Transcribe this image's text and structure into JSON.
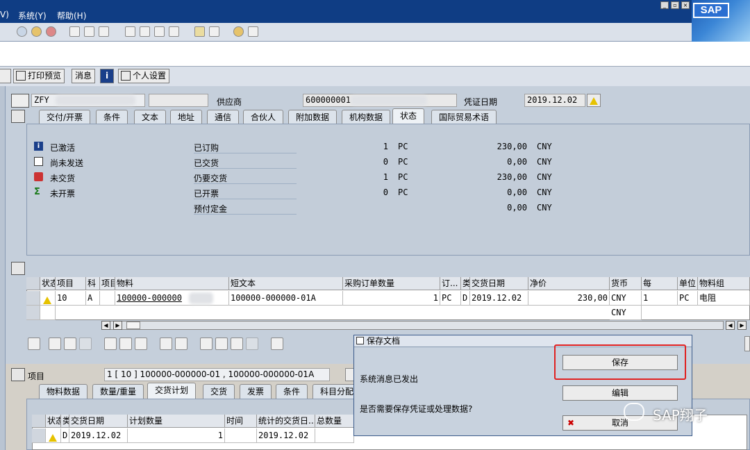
{
  "menu": {
    "view": "V)",
    "system": "系统(Y)",
    "help": "帮助(H)"
  },
  "toolbar_icons": [
    "back-icon",
    "exit-icon",
    "cancel-icon",
    "print-icon",
    "find-icon",
    "find-next-icon",
    "first-page-icon",
    "prev-page-icon",
    "next-page-icon",
    "last-page-icon",
    "new-session-icon",
    "shortcut-icon",
    "help-icon",
    "layout-icon"
  ],
  "app_toolbar": {
    "print_preview": "打印预览",
    "messages": "消息",
    "personal_settings": "个人设置"
  },
  "header": {
    "doc_type": "ZFY",
    "vendor_label": "供应商",
    "vendor_value": "600000001",
    "doc_date_label": "凭证日期",
    "doc_date_value": "2019.12.02"
  },
  "header_tabs": [
    "交付/开票",
    "条件",
    "文本",
    "地址",
    "通信",
    "合伙人",
    "附加数据",
    "机构数据",
    "状态",
    "国际贸易术语"
  ],
  "status_panel": {
    "flags": [
      {
        "icon": "info-icon",
        "label": "已激活"
      },
      {
        "icon": "printer-icon",
        "label": "尚未发送"
      },
      {
        "icon": "truck-icon",
        "label": "未交货"
      },
      {
        "icon": "sigma-icon",
        "label": "未开票"
      }
    ],
    "rows": [
      {
        "label": "已订购",
        "qty": "1",
        "unit": "PC",
        "amount": "230,00",
        "currency": "CNY"
      },
      {
        "label": "已交货",
        "qty": "0",
        "unit": "PC",
        "amount": "0,00",
        "currency": "CNY"
      },
      {
        "label": "仍要交货",
        "qty": "1",
        "unit": "PC",
        "amount": "230,00",
        "currency": "CNY"
      },
      {
        "label": "已开票",
        "qty": "0",
        "unit": "PC",
        "amount": "0,00",
        "currency": "CNY"
      },
      {
        "label": "预付定金",
        "qty": "",
        "unit": "",
        "amount": "0,00",
        "currency": "CNY"
      }
    ]
  },
  "item_grid": {
    "columns": [
      "状态",
      "项目",
      "科",
      "项目",
      "物料",
      "短文本",
      "采购订单数量",
      "订...",
      "类",
      "交货日期",
      "净价",
      "货币",
      "每",
      "单位",
      "物料组"
    ],
    "row1": {
      "item": "10",
      "acct": "A",
      "material": "100000-000000",
      "short_text": "100000-000000-01A",
      "qty": "1",
      "order_unit": "PC",
      "cat": "D",
      "delivery_date": "2019.12.02",
      "net_price": "230,00",
      "currency": "CNY",
      "per": "1",
      "unit": "PC",
      "mat_group": "电阻"
    },
    "row2": {
      "currency": "CNY"
    }
  },
  "item_detail": {
    "label": "项目",
    "selector": "1 [ 10 ] 100000-000000-01 , 100000-000000-01A"
  },
  "item_tabs": [
    "物料数据",
    "数量/重量",
    "交货计划",
    "交货",
    "发票",
    "条件",
    "科目分配"
  ],
  "schedule_grid": {
    "columns": [
      "状态",
      "类",
      "交货日期",
      "计划数量",
      "时间",
      "统计的交货日...",
      "总数量"
    ],
    "row1": {
      "cat": "D",
      "date": "2019.12.02",
      "qty": "1",
      "stat_date": "2019.12.02"
    }
  },
  "dialog": {
    "title": "保存文档",
    "message1": "系统消息已发出",
    "message2": "是否需要保存凭证或处理数据?",
    "save": "保存",
    "edit": "编辑",
    "cancel": "取消"
  },
  "watermark": "SAP翔子",
  "sap_logo": "SAP"
}
